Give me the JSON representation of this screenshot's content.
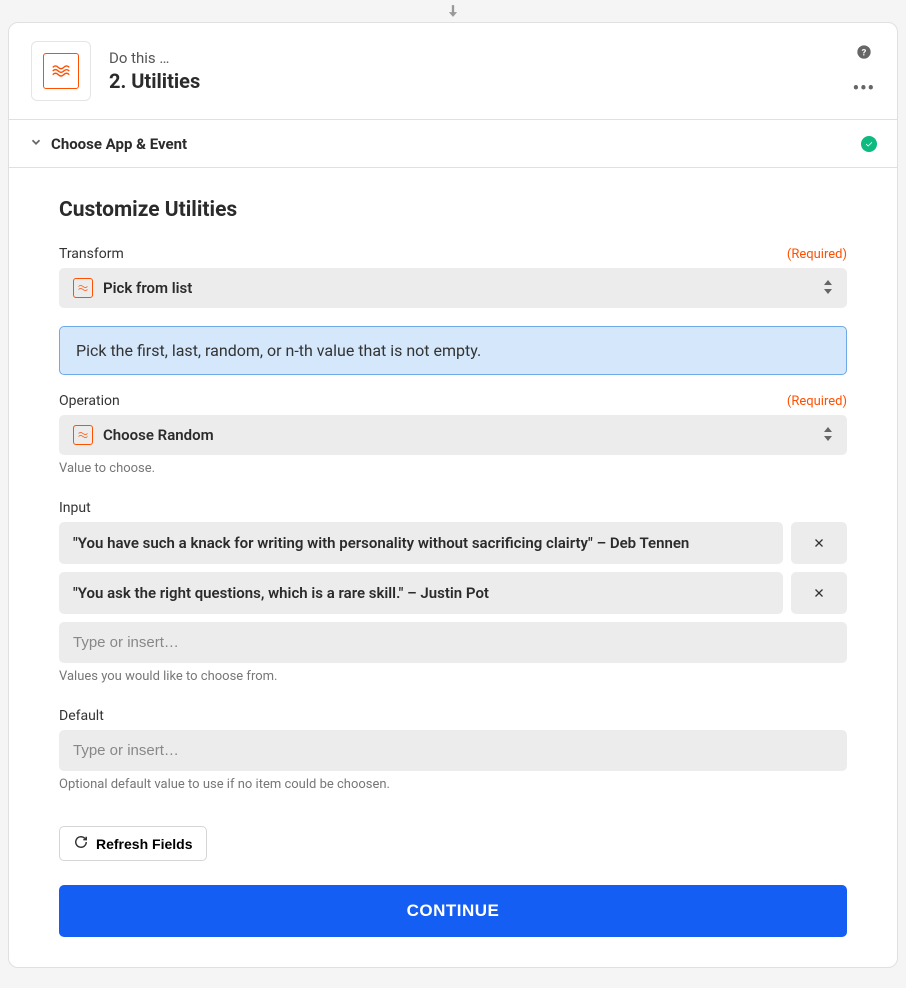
{
  "header": {
    "subtitle": "Do this …",
    "title": "2. Utilities"
  },
  "section_choose": {
    "label": "Choose App & Event"
  },
  "customize": {
    "title": "Customize Utilities",
    "transform": {
      "label": "Transform",
      "required": "(Required)",
      "value": "Pick from list",
      "banner": "Pick the first, last, random, or n-th value that is not empty."
    },
    "operation": {
      "label": "Operation",
      "required": "(Required)",
      "value": "Choose Random",
      "help": "Value to choose."
    },
    "input": {
      "label": "Input",
      "items": [
        "\"You have such a knack for writing with personality without sacrificing clairty\" – Deb Tennen",
        "\"You ask the right questions, which is a rare skill.\" – Justin Pot"
      ],
      "placeholder": "Type or insert…",
      "help": "Values you would like to choose from."
    },
    "default": {
      "label": "Default",
      "placeholder": "Type or insert…",
      "help": "Optional default value to use if no item could be choosen."
    },
    "refresh_label": "Refresh Fields",
    "continue_label": "CONTINUE"
  }
}
